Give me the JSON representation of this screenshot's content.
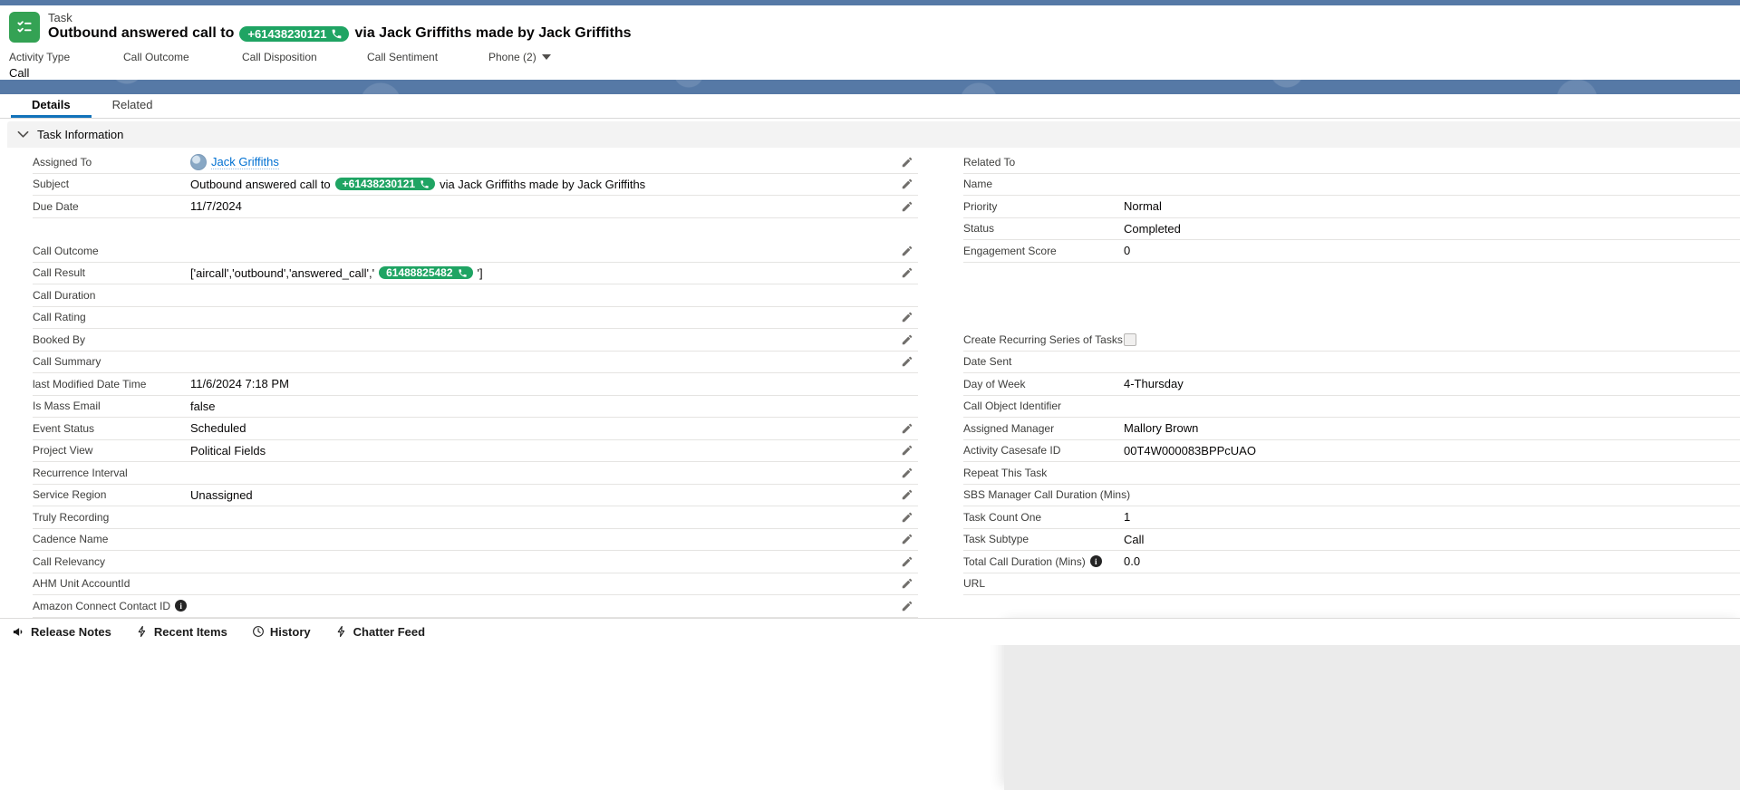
{
  "header": {
    "record_type": "Task",
    "title_prefix": "Outbound answered call to",
    "title_phone": "+61438230121",
    "title_suffix": "via Jack Griffiths made by Jack Griffiths"
  },
  "highlights": [
    {
      "label": "Activity Type",
      "value": "Call"
    },
    {
      "label": "Call Outcome",
      "value": ""
    },
    {
      "label": "Call Disposition",
      "value": ""
    },
    {
      "label": "Call Sentiment",
      "value": ""
    },
    {
      "label": "Phone (2)",
      "value": "",
      "dropdown": true
    }
  ],
  "tabs": [
    {
      "label": "Details",
      "active": true
    },
    {
      "label": "Related",
      "active": false
    }
  ],
  "section": {
    "title": "Task Information"
  },
  "details": {
    "rows": [
      [
        {
          "label": "Assigned To",
          "type": "user",
          "value": "Jack Griffiths",
          "editable": true
        },
        {
          "label": "Related To",
          "value": ""
        }
      ],
      [
        {
          "label": "Subject",
          "type": "phone-rich",
          "prefix": "Outbound answered call to ",
          "pill": "+61438230121",
          "suffix": " via Jack Griffiths made by Jack Griffiths",
          "editable": true
        },
        {
          "label": "Name",
          "value": ""
        }
      ],
      [
        {
          "label": "Due Date",
          "value": "11/7/2024",
          "editable": true
        },
        {
          "label": "Priority",
          "value": "Normal"
        }
      ],
      [
        null,
        {
          "label": "Status",
          "value": "Completed"
        }
      ],
      [
        {
          "label": "Call Outcome",
          "value": "",
          "editable": true
        },
        {
          "label": "Engagement Score",
          "value": "0"
        }
      ],
      [
        {
          "label": "Call Result",
          "type": "phone-rich",
          "prefix": "['aircall','outbound','answered_call','",
          "pill": "61488825482",
          "suffix": "']",
          "editable": true
        },
        null
      ],
      [
        {
          "label": "Call Duration",
          "value": "",
          "editable": false
        },
        null
      ],
      [
        {
          "label": "Call Rating",
          "value": "",
          "editable": true
        },
        null
      ],
      [
        {
          "label": "Booked By",
          "value": "",
          "editable": true
        },
        {
          "label": "Create Recurring Series of Tasks",
          "type": "checkbox",
          "checked": false
        }
      ],
      [
        {
          "label": "Call Summary",
          "value": "",
          "editable": true
        },
        {
          "label": "Date Sent",
          "value": ""
        }
      ],
      [
        {
          "label": "last Modified Date Time",
          "value": "11/6/2024 7:18 PM",
          "editable": false
        },
        {
          "label": "Day of Week",
          "value": "4-Thursday"
        }
      ],
      [
        {
          "label": "Is Mass Email",
          "value": "false",
          "editable": false
        },
        {
          "label": "Call Object Identifier",
          "value": ""
        }
      ],
      [
        {
          "label": "Event Status",
          "value": "Scheduled",
          "editable": true
        },
        {
          "label": "Assigned Manager",
          "value": "Mallory Brown"
        }
      ],
      [
        {
          "label": "Project View",
          "value": "Political Fields",
          "editable": true
        },
        {
          "label": "Activity Casesafe ID",
          "value": "00T4W000083BPPcUAO"
        }
      ],
      [
        {
          "label": "Recurrence Interval",
          "value": "",
          "editable": true
        },
        {
          "label": "Repeat This Task",
          "value": ""
        }
      ],
      [
        {
          "label": "Service Region",
          "value": "Unassigned",
          "editable": true
        },
        {
          "label": "SBS Manager Call Duration (Mins)",
          "value": ""
        }
      ],
      [
        {
          "label": "Truly Recording",
          "value": "",
          "editable": true
        },
        {
          "label": "Task Count One",
          "value": "1"
        }
      ],
      [
        {
          "label": "Cadence Name",
          "value": "",
          "editable": true
        },
        {
          "label": "Task Subtype",
          "value": "Call"
        }
      ],
      [
        {
          "label": "Call Relevancy",
          "value": "",
          "editable": true
        },
        {
          "label": "Total Call Duration (Mins)",
          "value": "0.0",
          "info": true
        }
      ],
      [
        {
          "label": "AHM Unit AccountId",
          "value": "",
          "editable": true
        },
        {
          "label": "URL",
          "value": ""
        }
      ],
      [
        {
          "label": "Amazon Connect Contact ID",
          "value": "",
          "editable": true,
          "info": true
        },
        null
      ]
    ]
  },
  "footer": {
    "items": [
      {
        "label": "Release Notes",
        "icon": "megaphone-icon"
      },
      {
        "label": "Recent Items",
        "icon": "bolt-icon"
      },
      {
        "label": "History",
        "icon": "clock-icon"
      },
      {
        "label": "Chatter Feed",
        "icon": "bolt-icon"
      }
    ]
  },
  "colors": {
    "banner_blue": "#5679a6",
    "task_icon_green": "#34a254",
    "phone_pill_green": "#1fa463",
    "link_blue": "#0070d2",
    "active_tab_underline": "#1272ba"
  }
}
